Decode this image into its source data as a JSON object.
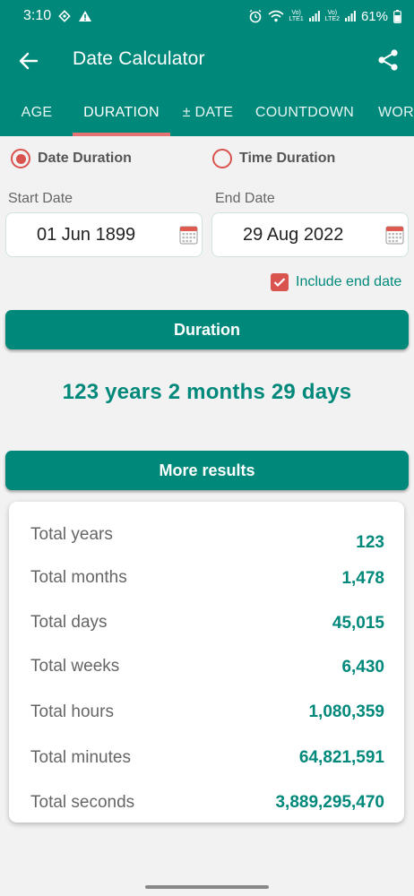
{
  "status_bar": {
    "time": "3:10",
    "vo1": "Vo)",
    "lte1": "LTE1",
    "vo2": "Vo)",
    "lte2": "LTE2",
    "battery": "61%"
  },
  "app_bar": {
    "title": "Date Calculator"
  },
  "tabs": [
    {
      "label": "AGE"
    },
    {
      "label": "DURATION"
    },
    {
      "label": "± DATE"
    },
    {
      "label": "COUNTDOWN"
    },
    {
      "label": "WORK"
    }
  ],
  "active_tab": "DURATION",
  "mode": {
    "date_duration": "Date Duration",
    "time_duration": "Time Duration",
    "selected": "Date Duration"
  },
  "start": {
    "label": "Start Date",
    "value": "01 Jun 1899"
  },
  "end": {
    "label": "End Date",
    "value": "29 Aug 2022"
  },
  "include_end_date": {
    "label": "Include end date",
    "checked": true
  },
  "duration_button": "Duration",
  "result_text": "123 years 2 months 29 days",
  "more_results_button": "More results",
  "results": [
    {
      "label": "Total years",
      "value": "123"
    },
    {
      "label": "Total months",
      "value": "1,478"
    },
    {
      "label": "Total days",
      "value": "45,015"
    },
    {
      "label": "Total weeks",
      "value": "6,430"
    },
    {
      "label": "Total hours",
      "value": "1,080,359"
    },
    {
      "label": "Total minutes",
      "value": "64,821,591"
    },
    {
      "label": "Total seconds",
      "value": "3,889,295,470"
    }
  ],
  "colors": {
    "primary": "#00897b",
    "accent": "#d9534f",
    "background": "#f2f2f2"
  }
}
